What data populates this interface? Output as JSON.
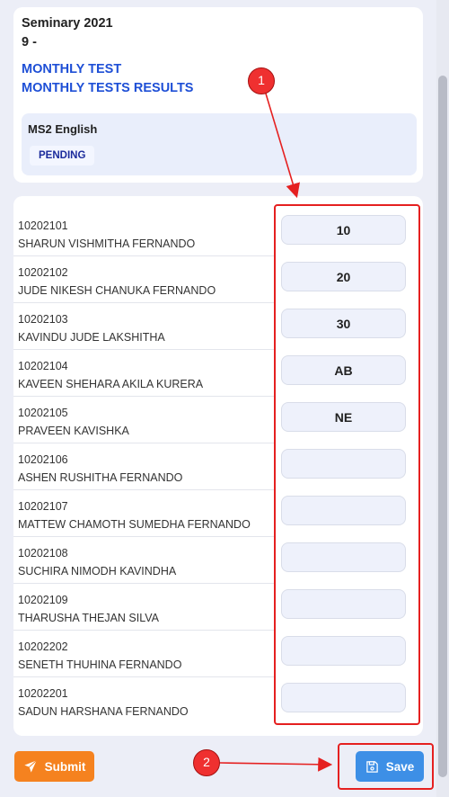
{
  "header": {
    "title": "Seminary 2021",
    "subtitle": "9 -",
    "links": [
      "MONTHLY TEST",
      "MONTHLY TESTS RESULTS"
    ]
  },
  "subject": {
    "name": "MS2 English",
    "status": "PENDING"
  },
  "students": [
    {
      "id": "10202101",
      "name": "SHARUN VISHMITHA FERNANDO",
      "mark": "10"
    },
    {
      "id": "10202102",
      "name": "JUDE NIKESH CHANUKA FERNANDO",
      "mark": "20"
    },
    {
      "id": "10202103",
      "name": "KAVINDU JUDE LAKSHITHA",
      "mark": "30"
    },
    {
      "id": "10202104",
      "name": "KAVEEN SHEHARA AKILA KURERA",
      "mark": "AB"
    },
    {
      "id": "10202105",
      "name": "PRAVEEN KAVISHKA",
      "mark": "NE"
    },
    {
      "id": "10202106",
      "name": "ASHEN RUSHITHA FERNANDO",
      "mark": ""
    },
    {
      "id": "10202107",
      "name": "MATTEW CHAMOTH SUMEDHA FERNANDO",
      "mark": ""
    },
    {
      "id": "10202108",
      "name": "SUCHIRA NIMODH KAVINDHA",
      "mark": ""
    },
    {
      "id": "10202109",
      "name": "THARUSHA THEJAN SILVA",
      "mark": ""
    },
    {
      "id": "10202202",
      "name": "SENETH THUHINA FERNANDO",
      "mark": ""
    },
    {
      "id": "10202201",
      "name": "SADUN HARSHANA FERNANDO",
      "mark": ""
    }
  ],
  "actions": {
    "submit_label": "Submit",
    "submit_icon": "paper-plane-icon",
    "save_label": "Save",
    "save_icon": "floppy-disk-icon"
  },
  "annotations": [
    {
      "number": "1"
    },
    {
      "number": "2"
    }
  ],
  "colors": {
    "link": "#1e4fd6",
    "status_badge_text": "#1b2b9b",
    "submit_button": "#f5821f",
    "save_button": "#3d8fe6",
    "annotation": "#e52020"
  }
}
